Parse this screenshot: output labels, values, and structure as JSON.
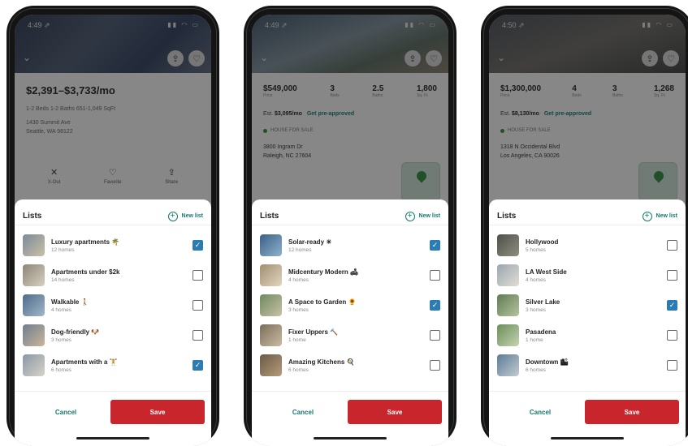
{
  "colors": {
    "accent": "#137a6e",
    "save": "#c8262c",
    "checked": "#2b7bb5"
  },
  "phones": [
    {
      "status": {
        "time": "4:49 ⇗"
      },
      "listing": {
        "price": "$2,391–$3,733/mo",
        "summary": "1-2 Beds   1-2 Baths   651-1,049 SqFt",
        "address_line1": "1430 Summit Ave",
        "address_line2": "Seattle, WA 98122",
        "actions": [
          "X-Out",
          "Favorite",
          "Share"
        ]
      },
      "sheet": {
        "title": "Lists",
        "new_list_label": "New list",
        "items": [
          {
            "name": "Luxury apartments 🌴",
            "count": "12 homes",
            "checked": true
          },
          {
            "name": "Apartments under $2k",
            "count": "14 homes",
            "checked": false
          },
          {
            "name": "Walkable 🚶",
            "count": "4 homes",
            "checked": false
          },
          {
            "name": "Dog-friendly 🐶",
            "count": "3 homes",
            "checked": false
          },
          {
            "name": "Apartments with a 🏋",
            "count": "6 homes",
            "checked": true
          }
        ],
        "cancel_label": "Cancel",
        "save_label": "Save"
      }
    },
    {
      "status": {
        "time": "4:49 ⇗"
      },
      "listing": {
        "stats": [
          {
            "value": "$549,000",
            "label": "Price"
          },
          {
            "value": "3",
            "label": "Beds"
          },
          {
            "value": "2.5",
            "label": "Baths"
          },
          {
            "value": "1,800",
            "label": "Sq. Ft."
          }
        ],
        "est_prefix": "Est.",
        "est_value": "$3,095/mo",
        "preapproved": "Get pre-approved",
        "for_sale": "HOUSE FOR SALE",
        "address_line1": "3800 Ingram Dr",
        "address_line2": "Raleigh, NC 27604"
      },
      "sheet": {
        "title": "Lists",
        "new_list_label": "New list",
        "items": [
          {
            "name": "Solar-ready ☀",
            "count": "12 homes",
            "checked": true
          },
          {
            "name": "Midcentury Modern 🛋",
            "count": "4 homes",
            "checked": false
          },
          {
            "name": "A Space to Garden 🌻",
            "count": "3 homes",
            "checked": true
          },
          {
            "name": "Fixer Uppers 🔨",
            "count": "1 home",
            "checked": false
          },
          {
            "name": "Amazing Kitchens 🍳",
            "count": "6 homes",
            "checked": false
          }
        ],
        "cancel_label": "Cancel",
        "save_label": "Save"
      }
    },
    {
      "status": {
        "time": "4:50 ⇗"
      },
      "listing": {
        "stats": [
          {
            "value": "$1,300,000",
            "label": "Price"
          },
          {
            "value": "4",
            "label": "Beds"
          },
          {
            "value": "3",
            "label": "Baths"
          },
          {
            "value": "1,268",
            "label": "Sq. Ft."
          }
        ],
        "est_prefix": "Est.",
        "est_value": "$8,130/mo",
        "preapproved": "Get pre-approved",
        "for_sale": "HOUSE FOR SALE",
        "address_line1": "1318 N Occidental Blvd",
        "address_line2": "Los Angeles, CA 90026"
      },
      "sheet": {
        "title": "Lists",
        "new_list_label": "New list",
        "items": [
          {
            "name": "Hollywood",
            "count": "5 homes",
            "checked": false
          },
          {
            "name": "LA West Side",
            "count": "4 homes",
            "checked": false
          },
          {
            "name": "Silver Lake",
            "count": "3 homes",
            "checked": true
          },
          {
            "name": "Pasadena",
            "count": "1 home",
            "checked": false
          },
          {
            "name": "Downtown 🏙",
            "count": "6 homes",
            "checked": false
          }
        ],
        "cancel_label": "Cancel",
        "save_label": "Save"
      }
    }
  ]
}
